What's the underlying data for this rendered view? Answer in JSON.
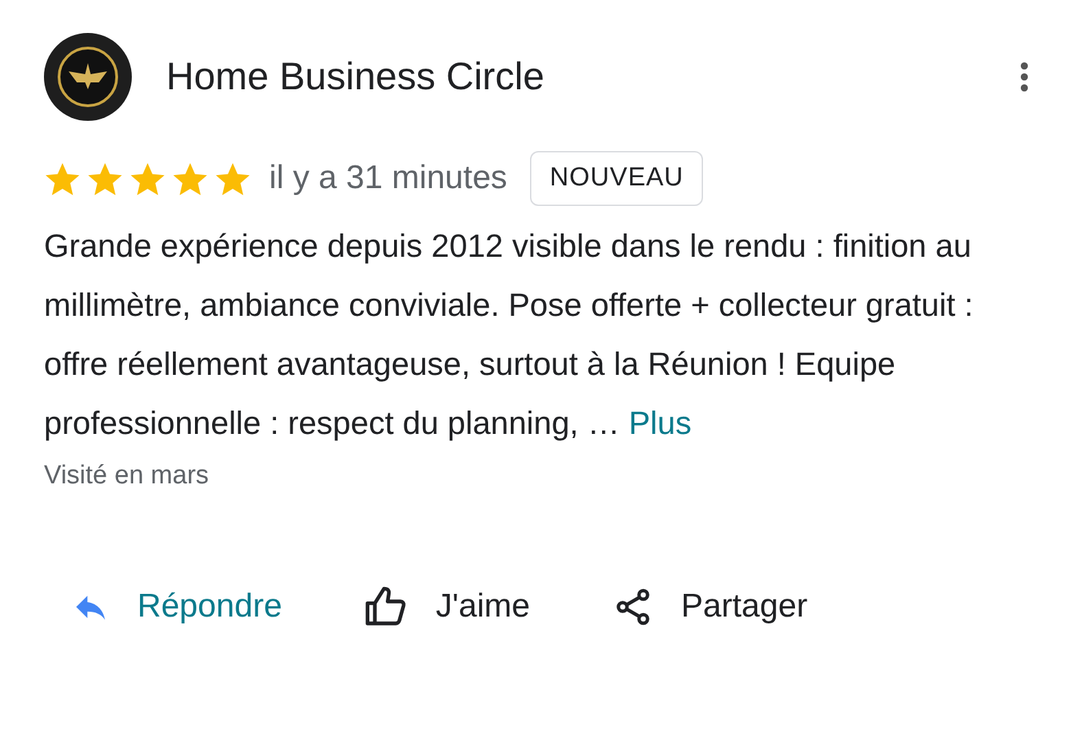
{
  "review": {
    "author": "Home Business Circle",
    "stars": 5,
    "time": "il y a 31 minutes",
    "badge": "NOUVEAU",
    "text": "Grande expérience depuis 2012 visible dans le rendu : finition au millimètre, ambiance conviviale. Pose offerte + collecteur gratuit : offre réellement avantageuse, surtout à la Réunion ! Equipe professionnelle : respect du planning, …",
    "more": "Plus",
    "visited": "Visité en mars"
  },
  "actions": [
    {
      "kind": "reply",
      "label": "Répondre"
    },
    {
      "kind": "like",
      "label": "J'aime"
    },
    {
      "kind": "share",
      "label": "Partager"
    }
  ]
}
